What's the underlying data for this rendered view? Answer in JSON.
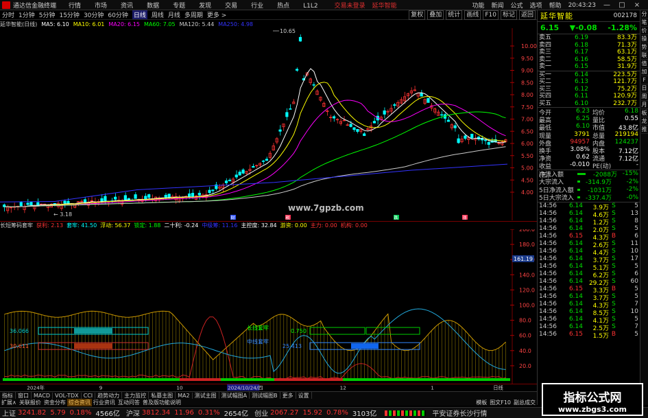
{
  "titlebar": {
    "app": "通达信金融终端",
    "menus": [
      "行情",
      "市场",
      "资讯",
      "数据",
      "专题",
      "发现",
      "交易",
      "行业",
      "热点",
      "L1L2"
    ],
    "alert1": "交易未登录",
    "alert2": "延华智能",
    "right": [
      "功能",
      "新闻",
      "公式",
      "选项",
      "帮助"
    ],
    "time": "20:43:23",
    "window": [
      "—",
      "□",
      "×"
    ]
  },
  "toolbar": {
    "periods": [
      "分时",
      "1分钟",
      "5分钟",
      "15分钟",
      "30分钟",
      "60分钟",
      "日线",
      "周线",
      "月线",
      "多周期",
      "更多 >"
    ],
    "active": "日线",
    "right": [
      "复权",
      "叠加",
      "统计",
      "画线",
      "F10",
      "标记",
      "返回"
    ]
  },
  "maline": {
    "name": "延华智能(日线)",
    "ma5": "MA5: 6.10",
    "ma10": "MA10: 6.01",
    "ma20": "MA20: 6.15",
    "ma60": "MA60: 7.05",
    "ma120": "MA120: 5.44",
    "ma250": "MA250: 4.98"
  },
  "colors": {
    "ma5": "#ffffff",
    "ma10": "#ffff00",
    "ma20": "#ff00ff",
    "ma60": "#00ff00",
    "ma120": "#cccccc",
    "ma250": "#3333ff",
    "up": "#ff3333",
    "down": "#00ffff",
    "green": "#00dd00",
    "yellow": "#ffff00"
  },
  "main_chart": {
    "yticks": [
      "10.00",
      "9.50",
      "9.00",
      "8.50",
      "8.00",
      "7.50",
      "7.00",
      "6.50",
      "6.00",
      "5.50",
      "5.00",
      "4.50",
      "4.00"
    ],
    "max_label": "10.65",
    "min_label": "3.18",
    "website": "www.7gpzb.com",
    "markers": [
      "财",
      "税",
      "跌",
      "涨"
    ]
  },
  "indicator": {
    "name": "长短筹码套牢",
    "items": [
      {
        "k": "获利",
        "v": "2.13"
      },
      {
        "k": "套牢",
        "v": "41.50"
      },
      {
        "k": "浮动",
        "v": "56.37"
      },
      {
        "k": "锁定",
        "v": "1.88"
      },
      {
        "k": "二十利",
        "v": "-0.24"
      },
      {
        "k": "中级筹",
        "v": "11.16"
      },
      {
        "k": "主控度",
        "v": "32.84"
      },
      {
        "k": "游资",
        "v": "0.00"
      },
      {
        "k": "主力",
        "v": "0.00"
      },
      {
        "k": "机构",
        "v": "0.00"
      }
    ],
    "yticks": [
      "200.0",
      "180.0",
      "160.0",
      "140.0",
      "120.0",
      "100.0",
      "80.0",
      "60.0",
      "40.0",
      "20.0"
    ],
    "cursor_val": "161.19",
    "labels": {
      "long": "长线套牢",
      "mid": "中线套牢",
      "v1": "36.066",
      "v2": "30.611",
      "v3": "0.750",
      "v4": "25.413"
    }
  },
  "datebar": {
    "labels": [
      "2024年",
      "9",
      "10",
      "2024/10/24/四",
      "12",
      "1"
    ],
    "right": "日线"
  },
  "tabs": [
    "指标",
    "窗口",
    "MACD",
    "VOL-TDX",
    "CCI",
    "趋势动力",
    "主力监控",
    "私募主图",
    "MA2",
    "测试主图",
    "测试幅图A",
    "测试幅图B",
    "更多",
    "设置"
  ],
  "subtabs": [
    "扩展∧",
    "关联报价",
    "资金分布",
    "综合资讯",
    "行业资讯",
    "互动问答",
    "普及版功能说明"
  ],
  "subtabs_right": [
    "模板",
    "图文F10",
    "副总成交"
  ],
  "stock": {
    "name": "延华智能",
    "code": "002178",
    "price": "6.15",
    "change": "▼-0.08",
    "pct": "-1.28%"
  },
  "orderbook": {
    "asks": [
      {
        "l": "卖五",
        "p": "6.19",
        "v": "83.3万"
      },
      {
        "l": "卖四",
        "p": "6.18",
        "v": "71.3万"
      },
      {
        "l": "卖三",
        "p": "6.17",
        "v": "63.1万"
      },
      {
        "l": "卖二",
        "p": "6.16",
        "v": "58.5万"
      },
      {
        "l": "卖一",
        "p": "6.15",
        "v": "31.9万"
      }
    ],
    "bids": [
      {
        "l": "买一",
        "p": "6.14",
        "v": "223.5万"
      },
      {
        "l": "买二",
        "p": "6.13",
        "v": "121.7万"
      },
      {
        "l": "买三",
        "p": "6.12",
        "v": "75.2万"
      },
      {
        "l": "买四",
        "p": "6.11",
        "v": "120.9万"
      },
      {
        "l": "买五",
        "p": "6.10",
        "v": "232.7万"
      }
    ]
  },
  "stats": [
    {
      "k": "今开",
      "a": "6.23",
      "k2": "均价",
      "b": "6.18"
    },
    {
      "k": "最高",
      "a": "6.25",
      "k2": "量比",
      "b": "0.55"
    },
    {
      "k": "最低",
      "a": "6.10",
      "k2": "市值",
      "b": "43.8亿"
    },
    {
      "k": "现量",
      "a": "3791",
      "k2": "总量",
      "b": "219194"
    },
    {
      "k": "外盘",
      "a": "94957",
      "k2": "内盘",
      "b": "124237"
    },
    {
      "k": "换手",
      "a": "3.08%",
      "k2": "股本",
      "b": "7.12亿"
    },
    {
      "k": "净资",
      "a": "0.62",
      "k2": "流通",
      "b": "7.12亿"
    },
    {
      "k": "收益(三)",
      "a": "-0.010",
      "k2": "PE(动)",
      "b": "-"
    }
  ],
  "flows": [
    {
      "k": "净流入额",
      "a": "-2088万",
      "b": "-15%"
    },
    {
      "k": "大宗流入",
      "a": "-314.9万",
      "b": "-2%"
    },
    {
      "k": "5日净流入额",
      "a": "-1031万",
      "b": "-2%"
    },
    {
      "k": "5日大宗流入",
      "a": "-337.4万",
      "b": "-0%"
    }
  ],
  "ticks": [
    {
      "t": "14:56",
      "p": "6.14",
      "v": "3.9万",
      "s": "S",
      "n": "5"
    },
    {
      "t": "14:56",
      "p": "6.14",
      "v": "4.6万",
      "s": "S",
      "n": "13"
    },
    {
      "t": "14:56",
      "p": "6.14",
      "v": "1.2万",
      "s": "S",
      "n": "8"
    },
    {
      "t": "14:56",
      "p": "6.14",
      "v": "2.0万",
      "s": "S",
      "n": "5"
    },
    {
      "t": "14:56",
      "p": "6.15",
      "v": "4.3万",
      "s": "B",
      "n": "6"
    },
    {
      "t": "14:56",
      "p": "6.14",
      "v": "2.6万",
      "s": "S",
      "n": "11"
    },
    {
      "t": "14:56",
      "p": "6.14",
      "v": "4.4万",
      "s": "S",
      "n": "10"
    },
    {
      "t": "14:56",
      "p": "6.14",
      "v": "3.7万",
      "s": "S",
      "n": "17"
    },
    {
      "t": "14:56",
      "p": "6.14",
      "v": "5.1万",
      "s": "S",
      "n": "5"
    },
    {
      "t": "14:56",
      "p": "6.14",
      "v": "6.2万",
      "s": "S",
      "n": "6"
    },
    {
      "t": "14:56",
      "p": "6.14",
      "v": "29.2万",
      "s": "S",
      "n": "60"
    },
    {
      "t": "14:56",
      "p": "6.15",
      "v": "3.3万",
      "s": "B",
      "n": "5"
    },
    {
      "t": "14:56",
      "p": "6.14",
      "v": "3.7万",
      "s": "S",
      "n": "5"
    },
    {
      "t": "14:56",
      "p": "6.14",
      "v": "4.3万",
      "s": "S",
      "n": "7"
    },
    {
      "t": "14:56",
      "p": "6.14",
      "v": "8.5万",
      "s": "S",
      "n": "10"
    },
    {
      "t": "14:56",
      "p": "6.14",
      "v": "4.1万",
      "s": "S",
      "n": "5"
    },
    {
      "t": "14:56",
      "p": "6.14",
      "v": "2.5万",
      "s": "S",
      "n": "7"
    },
    {
      "t": "14:56",
      "p": "6.15",
      "v": "1.5万",
      "s": "B",
      "n": "5"
    }
  ],
  "strip": [
    "分",
    "笔",
    "价",
    "操",
    "势",
    "联",
    "值",
    "加",
    "F",
    "日",
    "周",
    "月",
    "板",
    "龙",
    "推"
  ],
  "statusbar": {
    "sh_lbl": "上证",
    "sh": "3241.82",
    "sh_c": "5.79",
    "sh_p": "0.18%",
    "sh_v": "4566亿",
    "sz_lbl": "沪深",
    "sz": "3812.34",
    "sz_c": "11.96",
    "sz_p": "0.31%",
    "sz_v": "2654亿",
    "cy_lbl": "创业",
    "cy": "2067.27",
    "cy_c": "15.92",
    "cy_p": "0.78%",
    "cy_v": "3103亿",
    "broker": "平安证券长沙行情"
  },
  "watermark": {
    "line1": "指标公式网",
    "line2": "www.zbgs3.com"
  }
}
